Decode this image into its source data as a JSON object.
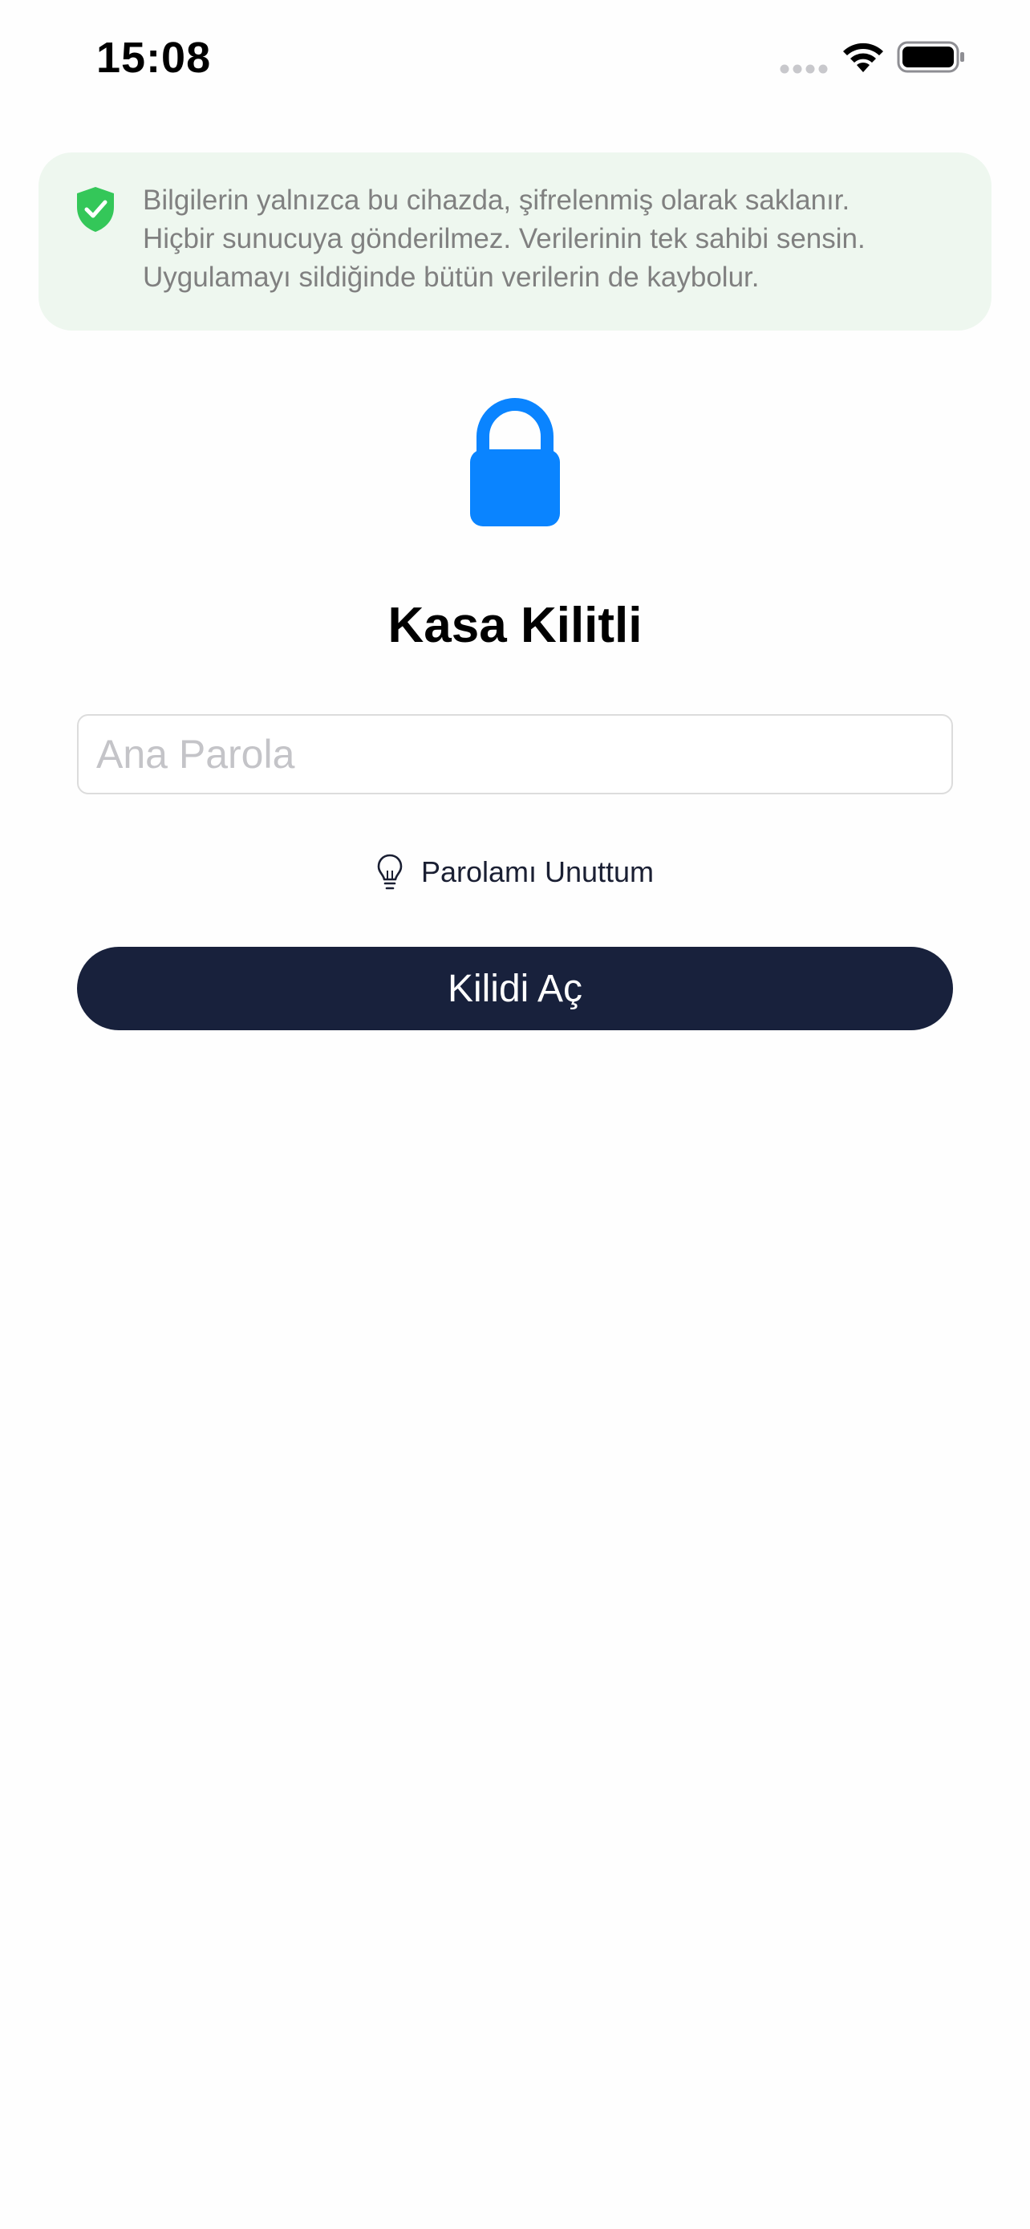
{
  "status_bar": {
    "time": "15:08",
    "icons": [
      "signal-dots-icon",
      "wifi-icon",
      "battery-icon"
    ]
  },
  "info_banner": {
    "icon": "shield-check-icon",
    "lines": [
      "Bilgilerin yalnızca bu cihazda, şifrelenmiş olarak saklanır.",
      "Hiçbir sunucuya gönderilmez. Verilerinin tek sahibi sensin.",
      "Uygulamayı sildiğinde bütün verilerin de kaybolur."
    ]
  },
  "vault": {
    "icon": "lock-icon",
    "title": "Kasa Kilitli"
  },
  "password_field": {
    "placeholder": "Ana Parola",
    "value": ""
  },
  "forgot": {
    "icon": "lightbulb-icon",
    "label": "Parolamı Unuttum"
  },
  "unlock_button": {
    "label": "Kilidi Aç"
  },
  "colors": {
    "accent_blue": "#0A84FF",
    "shield_green": "#34C759",
    "banner_bg": "#EEF7EF",
    "button_bg": "#18213C"
  }
}
